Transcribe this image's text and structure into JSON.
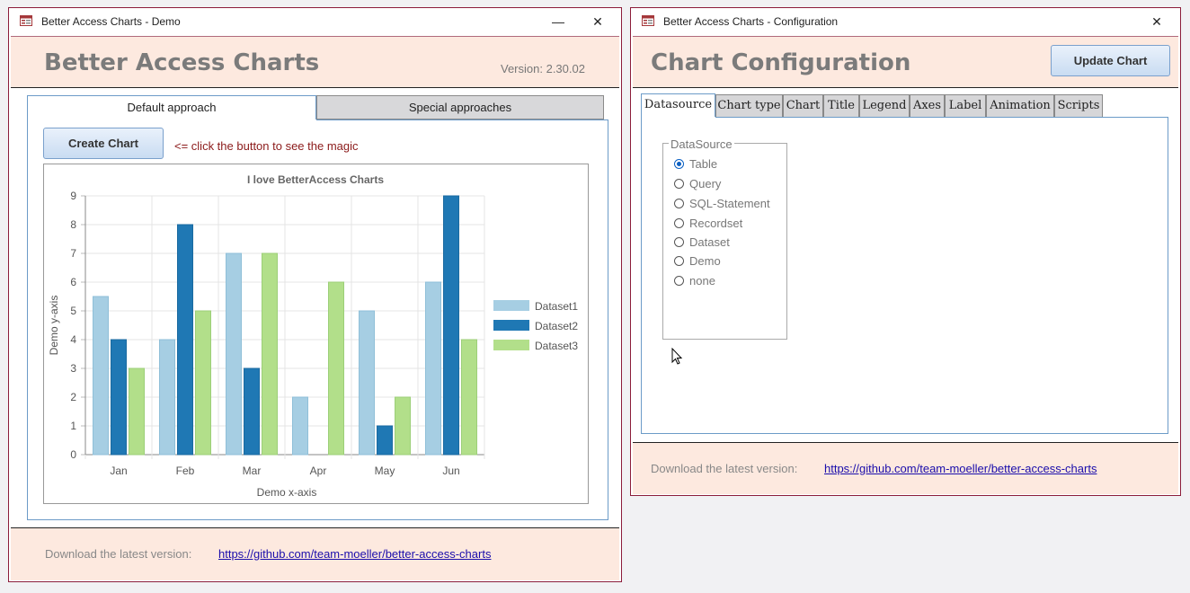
{
  "demo_window": {
    "title": "Better Access Charts - Demo",
    "heading": "Better Access Charts",
    "version": "Version: 2.30.02",
    "tabs": [
      "Default approach",
      "Special approaches"
    ],
    "create_button": "Create Chart",
    "hint": "<= click the button to see the magic",
    "footer_label": "Download the latest version:",
    "footer_link": "https://github.com/team-moeller/better-access-charts"
  },
  "chart_data": {
    "type": "bar",
    "title": "I love BetterAccess Charts",
    "xlabel": "Demo x-axis",
    "ylabel": "Demo y-axis",
    "categories": [
      "Jan",
      "Feb",
      "Mar",
      "Apr",
      "May",
      "Jun"
    ],
    "ylim": [
      0,
      9
    ],
    "yticks": [
      "0",
      "1",
      "2",
      "3",
      "4",
      "5",
      "6",
      "7",
      "8",
      "9"
    ],
    "grid": true,
    "legend": "right",
    "series": [
      {
        "name": "Dataset1",
        "values": [
          5.5,
          4,
          7,
          2,
          5,
          6
        ],
        "color": "#a6cee3"
      },
      {
        "name": "Dataset2",
        "values": [
          4,
          8,
          3,
          0,
          1,
          9
        ],
        "color": "#1f78b4"
      },
      {
        "name": "Dataset3",
        "values": [
          3,
          5,
          7,
          6,
          2,
          4
        ],
        "color": "#b2df8a"
      }
    ]
  },
  "config_window": {
    "title": "Better Access Charts - Configuration",
    "heading": "Chart Configuration",
    "update_button": "Update Chart",
    "tabs": [
      "Datasource",
      "Chart type",
      "Chart",
      "Title",
      "Legend",
      "Axes",
      "Label",
      "Animation",
      "Scripts"
    ],
    "datasource_legend": "DataSource",
    "options": [
      "Table",
      "Query",
      "SQL-Statement",
      "Recordset",
      "Dataset",
      "Demo",
      "none"
    ],
    "selected_option": "Table",
    "footer_label": "Download the latest version:",
    "footer_link": "https://github.com/team-moeller/better-access-charts"
  },
  "icons": {
    "app": "access-form-icon",
    "minimize": "minimize-icon",
    "close": "close-icon",
    "cursor": "mouse-pointer-icon"
  }
}
